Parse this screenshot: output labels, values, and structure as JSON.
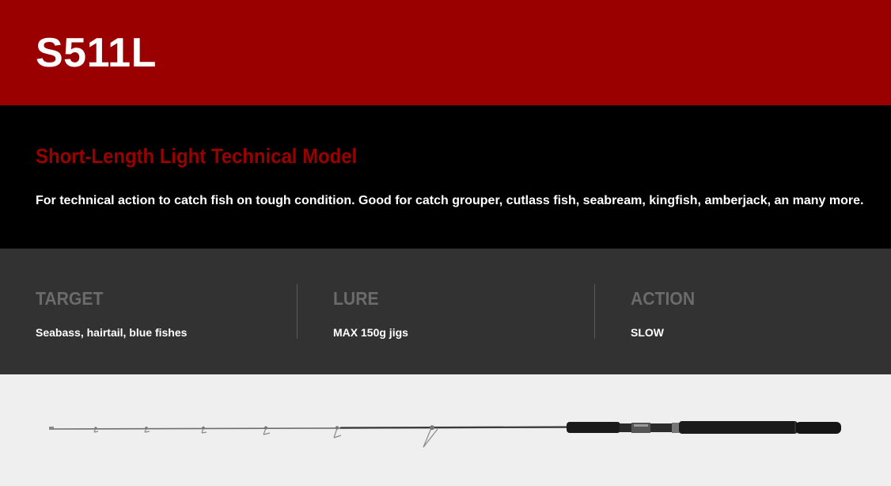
{
  "header": {
    "model": "S511L"
  },
  "description": {
    "title": "Short-Length Light Technical Model",
    "body": "For technical action to catch fish on tough condition. Good for catch grouper, cutlass fish, seabream, kingfish, amberjack, an many more."
  },
  "specs": [
    {
      "label": "TARGET",
      "value": "Seabass, hairtail, blue fishes"
    },
    {
      "label": "LURE",
      "value": "MAX 150g jigs"
    },
    {
      "label": "ACTION",
      "value": "SLOW"
    }
  ],
  "colors": {
    "brand_red": "#9b0000",
    "dark": "#000000",
    "spec_bg": "#323232",
    "product_bg": "#efefef"
  },
  "product_image": {
    "icon": "fishing-rod-image"
  }
}
